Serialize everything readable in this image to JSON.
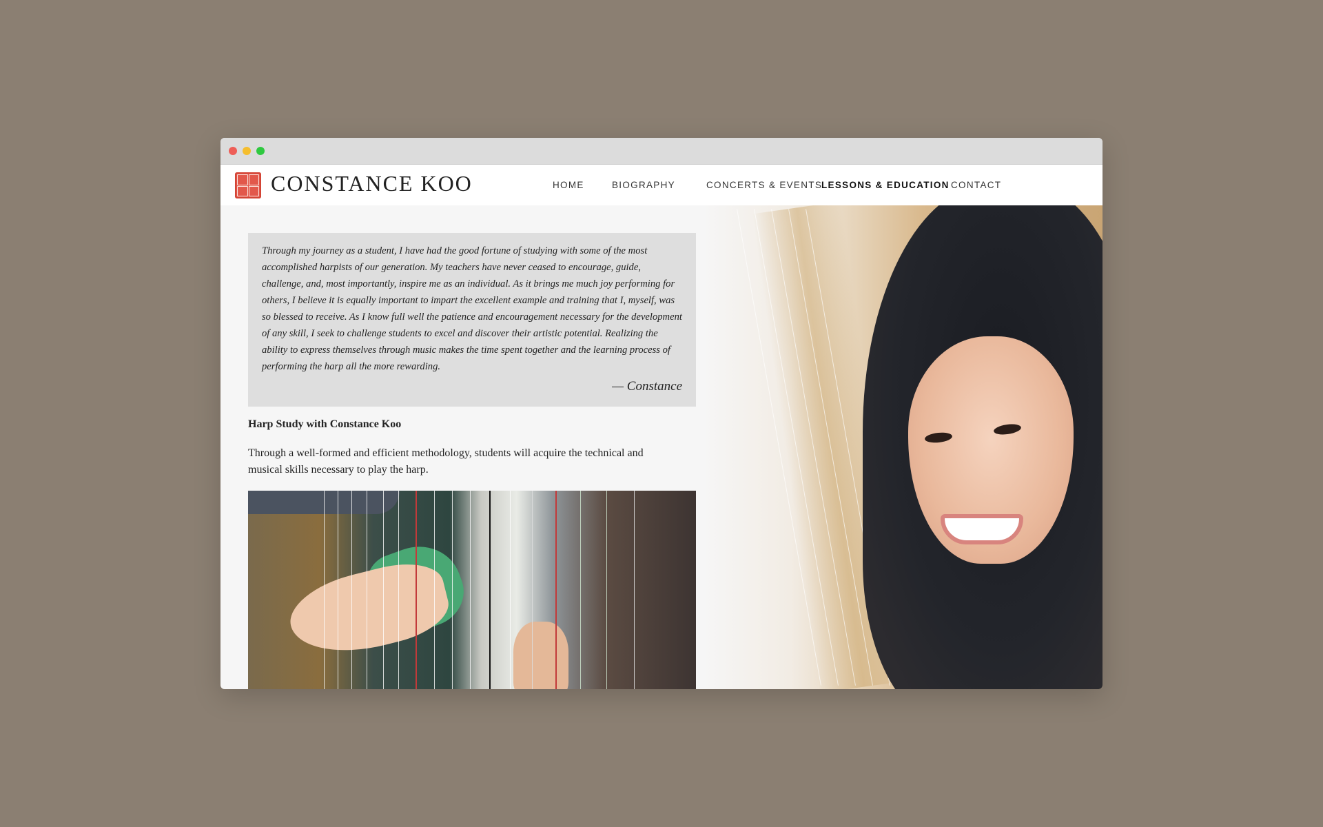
{
  "window": {
    "controls": [
      "close",
      "minimize",
      "maximize"
    ]
  },
  "header": {
    "logo_icon": "red-seal-logo",
    "brand": "CONSTANCE KOO",
    "nav": [
      {
        "label": "HOME",
        "active": false
      },
      {
        "label": "BIOGRAPHY",
        "active": false
      },
      {
        "label": "CONCERTS & EVENTS",
        "active": false
      },
      {
        "label": "LESSONS & EDUCATION",
        "active": true
      },
      {
        "label": "CONTACT",
        "active": false
      }
    ]
  },
  "quote": {
    "text": "Through my journey as a student, I have had the good fortune of studying with some of the most accomplished harpists of our generation. My teachers have never ceased to encourage, guide, challenge, and, most importantly, inspire me as an individual. As it brings me much joy performing for others, I believe it is equally important to impart the excellent example and training that I, myself, was so blessed to receive. As I know full well the patience and encouragement necessary for the development of any skill, I seek to challenge students to excel and discover their artistic potential. Realizing the ability to express themselves through music makes the time spent together and the learning process of performing the harp all the more rewarding.",
    "author": "— Constance"
  },
  "section": {
    "title": "Harp Study with Constance Koo",
    "body": "Through a well-formed and efficient methodology, students will acquire the technical and musical skills necessary to play the harp."
  },
  "colors": {
    "page_background": "#8b7f72",
    "quote_background": "#dedede",
    "logo_red": "#e2584b"
  }
}
